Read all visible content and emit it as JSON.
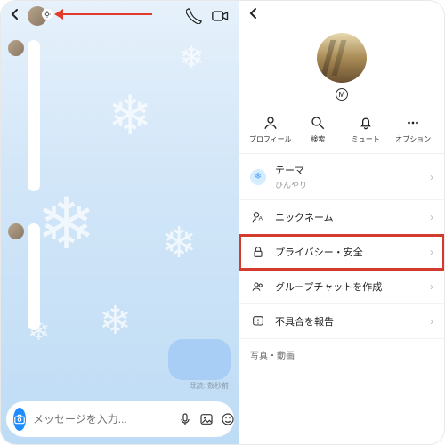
{
  "left": {
    "composer_placeholder": "メッセージを入力...",
    "read_timestamp": "既読: 数秒前"
  },
  "right": {
    "badge": "M",
    "actions": {
      "profile": "プロフィール",
      "search": "検索",
      "mute": "ミュート",
      "options": "オプション"
    },
    "rows": {
      "theme_label": "テーマ",
      "theme_sub": "ひんやり",
      "nickname": "ニックネーム",
      "privacy": "プライバシー・安全",
      "group": "グループチャットを作成",
      "report": "不具合を報告"
    },
    "media_section": "写真・動画"
  }
}
